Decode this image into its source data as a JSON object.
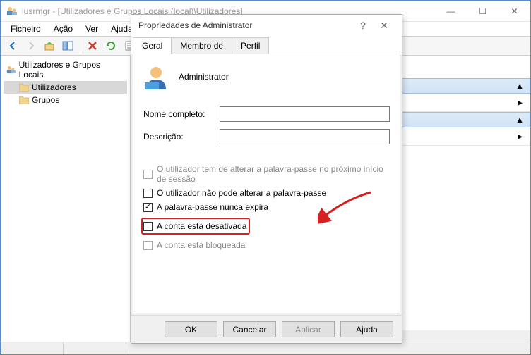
{
  "window": {
    "title": "lusrmgr - [Utilizadores e Grupos Locais (local)\\Utilizadores]"
  },
  "menu": {
    "file": "Ficheiro",
    "action": "Ação",
    "view": "Ver",
    "help": "Ajuda"
  },
  "tree": {
    "root": "Utilizadores e Grupos Locais",
    "users": "Utilizadores",
    "groups": "Grupos"
  },
  "dialog": {
    "title": "Propriedades de Administrator",
    "tabs": {
      "general": "Geral",
      "member": "Membro de",
      "profile": "Perfil"
    },
    "username": "Administrator",
    "fullname_label": "Nome completo:",
    "fullname_value": "",
    "desc_label": "Descrição:",
    "desc_value": "",
    "chk_must_change": "O utilizador tem de alterar a palavra-passe no próximo início de sessão",
    "chk_cannot_change": "O utilizador não pode alterar a palavra-passe",
    "chk_never_expires": "A palavra-passe nunca expira",
    "chk_disabled": "A conta está desativada",
    "chk_locked": "A conta está bloqueada",
    "btn_ok": "OK",
    "btn_cancel": "Cancelar",
    "btn_apply": "Aplicar",
    "btn_help": "Ajuda"
  }
}
